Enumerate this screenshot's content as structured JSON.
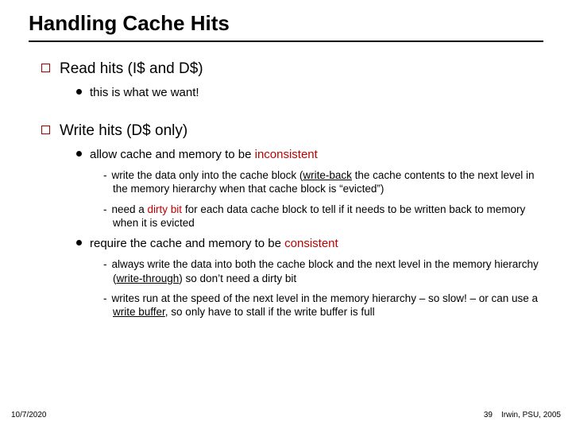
{
  "title": "Handling Cache Hits",
  "l1a": "Read hits (I$ and D$)",
  "l2a": "this is what we want!",
  "l1b": "Write hits (D$ only)",
  "l2b_pre": "allow cache and memory to be ",
  "l2b_red": "inconsistent",
  "l3a_pre": "write the data only into the cache block (",
  "l3a_key": "write-back",
  "l3a_post": " the cache contents to the next level in the memory hierarchy when that cache block is “evicted”)",
  "l3b_pre": "need a ",
  "l3b_key": "dirty bit",
  "l3b_post": " for each data cache block to tell if it needs to be written back to memory when it is evicted",
  "l2c_pre": "require the cache and memory to be ",
  "l2c_red": "consistent",
  "l3c_pre": "always write the data into both the cache block and the next level in the memory hierarchy (",
  "l3c_key": "write-through",
  "l3c_post": ") so don’t need a dirty bit",
  "l3d_pre": "writes run at the speed of the next level in the memory hierarchy – so slow! – or can use a ",
  "l3d_key": "write buffer",
  "l3d_post": ", so only have to stall if the write buffer is full",
  "footer": {
    "date": "10/7/2020",
    "page": "39",
    "attr": "Irwin, PSU, 2005"
  }
}
